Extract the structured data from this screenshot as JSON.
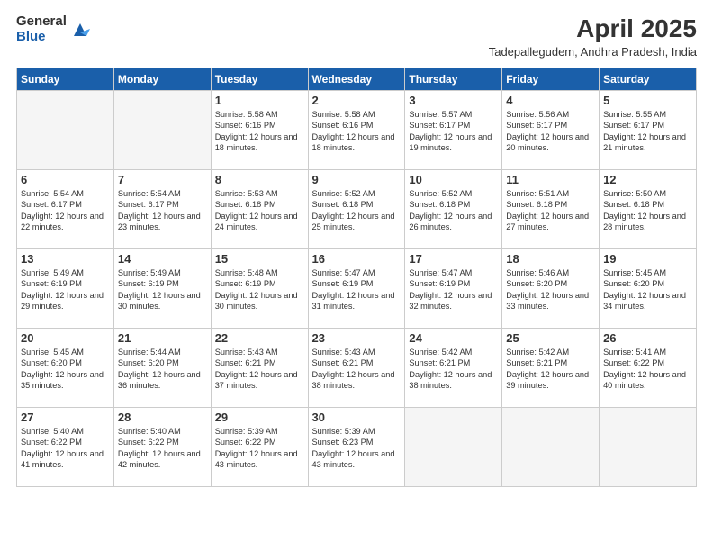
{
  "logo": {
    "general": "General",
    "blue": "Blue"
  },
  "title": "April 2025",
  "subtitle": "Tadepallegudem, Andhra Pradesh, India",
  "headers": [
    "Sunday",
    "Monday",
    "Tuesday",
    "Wednesday",
    "Thursday",
    "Friday",
    "Saturday"
  ],
  "weeks": [
    [
      {
        "day": "",
        "info": ""
      },
      {
        "day": "",
        "info": ""
      },
      {
        "day": "1",
        "info": "Sunrise: 5:58 AM\nSunset: 6:16 PM\nDaylight: 12 hours and 18 minutes."
      },
      {
        "day": "2",
        "info": "Sunrise: 5:58 AM\nSunset: 6:16 PM\nDaylight: 12 hours and 18 minutes."
      },
      {
        "day": "3",
        "info": "Sunrise: 5:57 AM\nSunset: 6:17 PM\nDaylight: 12 hours and 19 minutes."
      },
      {
        "day": "4",
        "info": "Sunrise: 5:56 AM\nSunset: 6:17 PM\nDaylight: 12 hours and 20 minutes."
      },
      {
        "day": "5",
        "info": "Sunrise: 5:55 AM\nSunset: 6:17 PM\nDaylight: 12 hours and 21 minutes."
      }
    ],
    [
      {
        "day": "6",
        "info": "Sunrise: 5:54 AM\nSunset: 6:17 PM\nDaylight: 12 hours and 22 minutes."
      },
      {
        "day": "7",
        "info": "Sunrise: 5:54 AM\nSunset: 6:17 PM\nDaylight: 12 hours and 23 minutes."
      },
      {
        "day": "8",
        "info": "Sunrise: 5:53 AM\nSunset: 6:18 PM\nDaylight: 12 hours and 24 minutes."
      },
      {
        "day": "9",
        "info": "Sunrise: 5:52 AM\nSunset: 6:18 PM\nDaylight: 12 hours and 25 minutes."
      },
      {
        "day": "10",
        "info": "Sunrise: 5:52 AM\nSunset: 6:18 PM\nDaylight: 12 hours and 26 minutes."
      },
      {
        "day": "11",
        "info": "Sunrise: 5:51 AM\nSunset: 6:18 PM\nDaylight: 12 hours and 27 minutes."
      },
      {
        "day": "12",
        "info": "Sunrise: 5:50 AM\nSunset: 6:18 PM\nDaylight: 12 hours and 28 minutes."
      }
    ],
    [
      {
        "day": "13",
        "info": "Sunrise: 5:49 AM\nSunset: 6:19 PM\nDaylight: 12 hours and 29 minutes."
      },
      {
        "day": "14",
        "info": "Sunrise: 5:49 AM\nSunset: 6:19 PM\nDaylight: 12 hours and 30 minutes."
      },
      {
        "day": "15",
        "info": "Sunrise: 5:48 AM\nSunset: 6:19 PM\nDaylight: 12 hours and 30 minutes."
      },
      {
        "day": "16",
        "info": "Sunrise: 5:47 AM\nSunset: 6:19 PM\nDaylight: 12 hours and 31 minutes."
      },
      {
        "day": "17",
        "info": "Sunrise: 5:47 AM\nSunset: 6:19 PM\nDaylight: 12 hours and 32 minutes."
      },
      {
        "day": "18",
        "info": "Sunrise: 5:46 AM\nSunset: 6:20 PM\nDaylight: 12 hours and 33 minutes."
      },
      {
        "day": "19",
        "info": "Sunrise: 5:45 AM\nSunset: 6:20 PM\nDaylight: 12 hours and 34 minutes."
      }
    ],
    [
      {
        "day": "20",
        "info": "Sunrise: 5:45 AM\nSunset: 6:20 PM\nDaylight: 12 hours and 35 minutes."
      },
      {
        "day": "21",
        "info": "Sunrise: 5:44 AM\nSunset: 6:20 PM\nDaylight: 12 hours and 36 minutes."
      },
      {
        "day": "22",
        "info": "Sunrise: 5:43 AM\nSunset: 6:21 PM\nDaylight: 12 hours and 37 minutes."
      },
      {
        "day": "23",
        "info": "Sunrise: 5:43 AM\nSunset: 6:21 PM\nDaylight: 12 hours and 38 minutes."
      },
      {
        "day": "24",
        "info": "Sunrise: 5:42 AM\nSunset: 6:21 PM\nDaylight: 12 hours and 38 minutes."
      },
      {
        "day": "25",
        "info": "Sunrise: 5:42 AM\nSunset: 6:21 PM\nDaylight: 12 hours and 39 minutes."
      },
      {
        "day": "26",
        "info": "Sunrise: 5:41 AM\nSunset: 6:22 PM\nDaylight: 12 hours and 40 minutes."
      }
    ],
    [
      {
        "day": "27",
        "info": "Sunrise: 5:40 AM\nSunset: 6:22 PM\nDaylight: 12 hours and 41 minutes."
      },
      {
        "day": "28",
        "info": "Sunrise: 5:40 AM\nSunset: 6:22 PM\nDaylight: 12 hours and 42 minutes."
      },
      {
        "day": "29",
        "info": "Sunrise: 5:39 AM\nSunset: 6:22 PM\nDaylight: 12 hours and 43 minutes."
      },
      {
        "day": "30",
        "info": "Sunrise: 5:39 AM\nSunset: 6:23 PM\nDaylight: 12 hours and 43 minutes."
      },
      {
        "day": "",
        "info": ""
      },
      {
        "day": "",
        "info": ""
      },
      {
        "day": "",
        "info": ""
      }
    ]
  ]
}
